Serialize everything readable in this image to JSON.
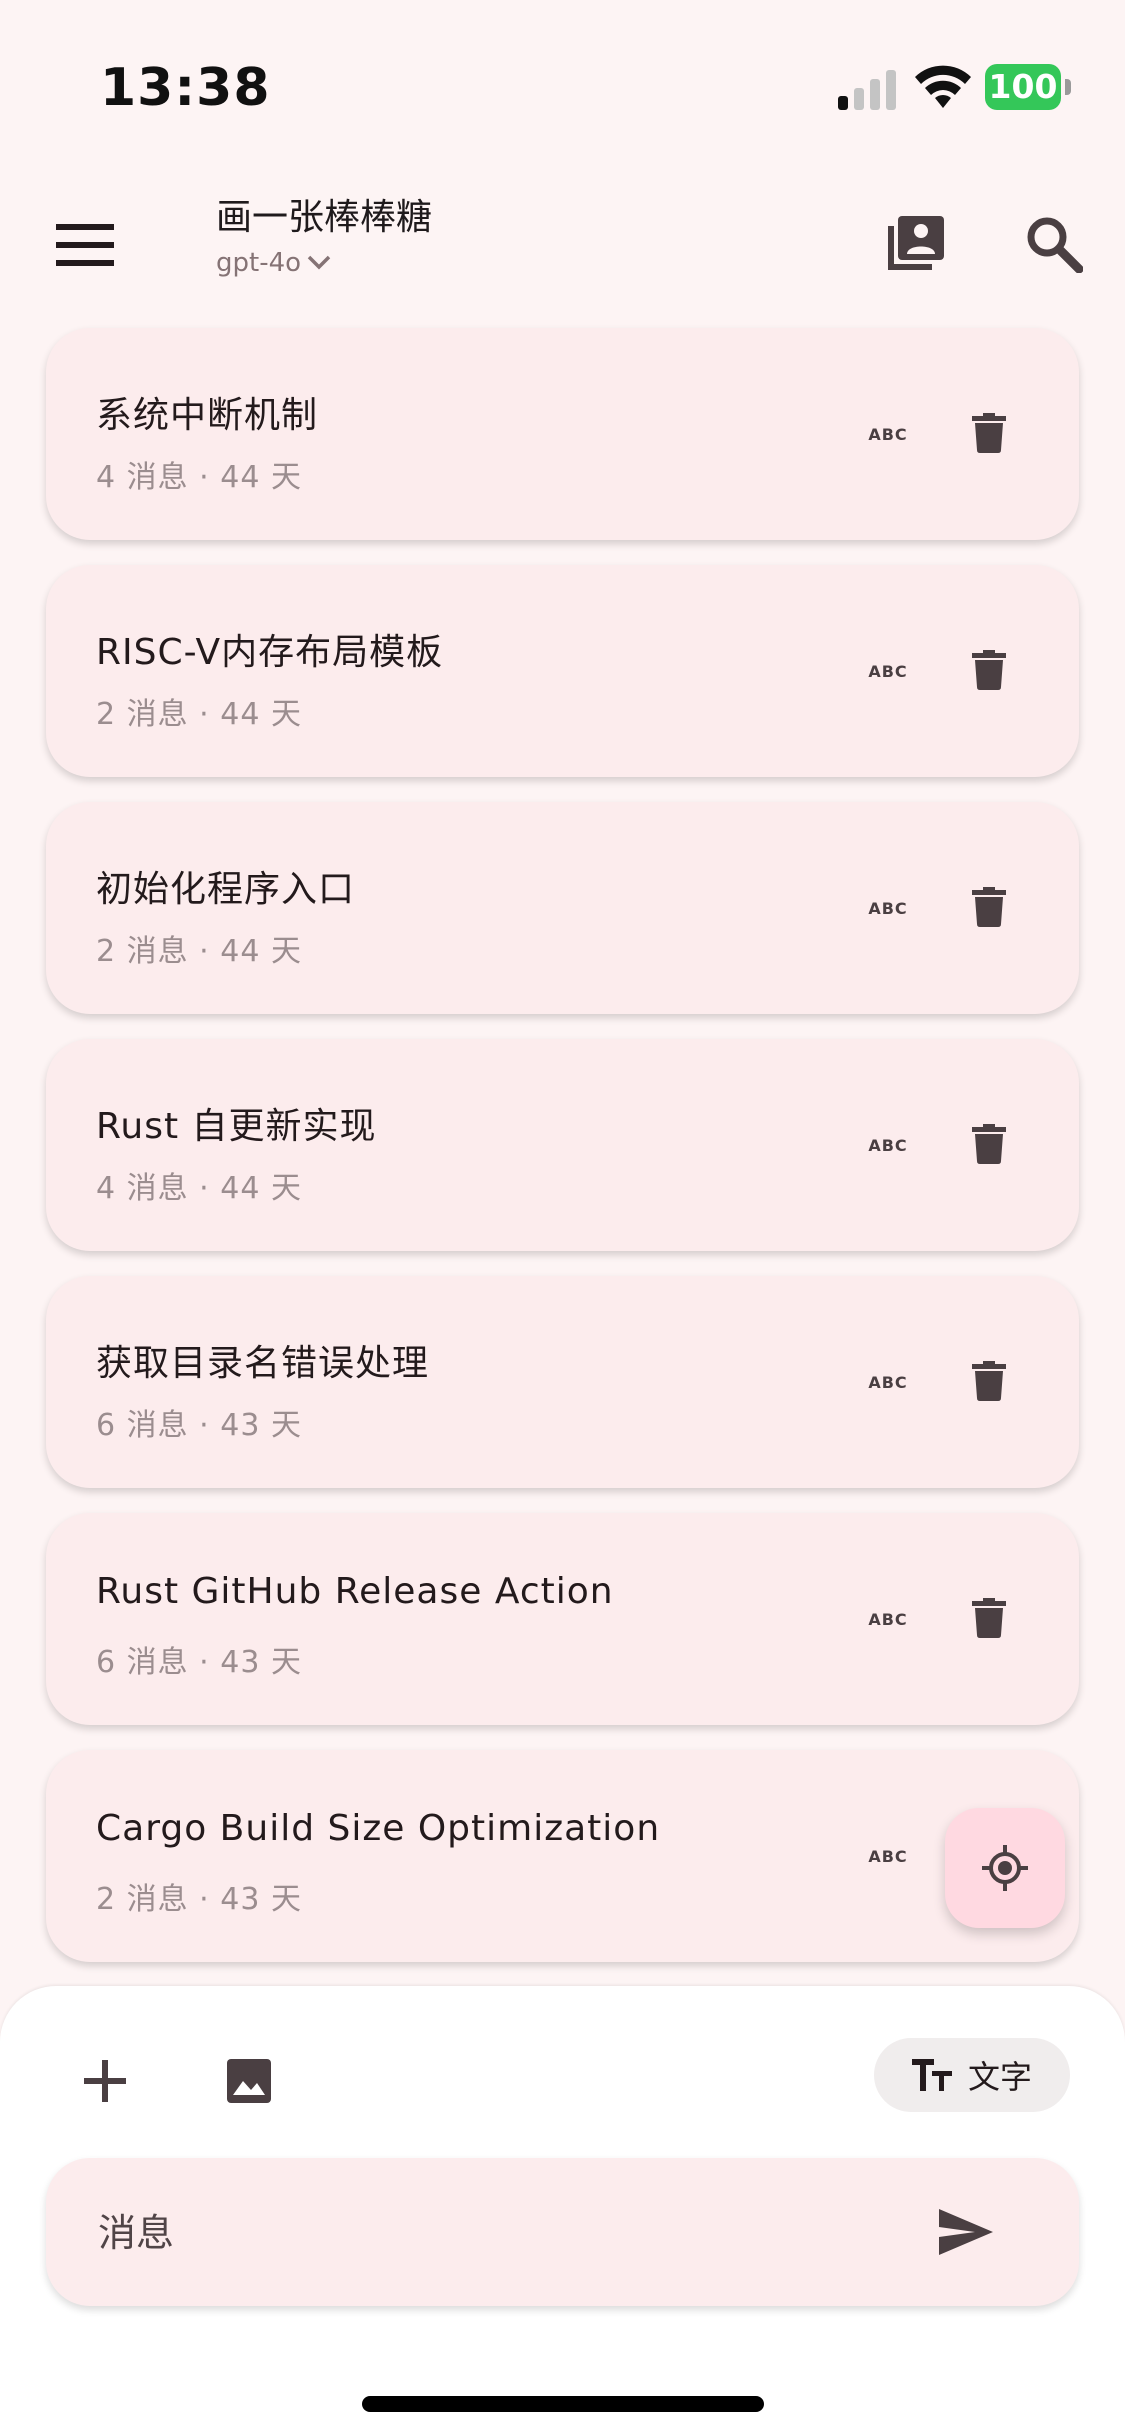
{
  "status_bar": {
    "time": "13:38",
    "battery": "100"
  },
  "header": {
    "title": "画一张棒棒糖",
    "model": "gpt-4o"
  },
  "conversations": [
    {
      "title": "系统中断机制",
      "meta": "4 消息 · 44 天"
    },
    {
      "title": "RISC-V内存布局模板",
      "meta": "2 消息 · 44 天"
    },
    {
      "title": "初始化程序入口",
      "meta": "2 消息 · 44 天"
    },
    {
      "title": "Rust 自更新实现",
      "meta": "4 消息 · 44 天"
    },
    {
      "title": "获取目录名错误处理",
      "meta": "6 消息 · 43 天"
    },
    {
      "title": "Rust GitHub Release Action",
      "meta": "6 消息 · 43 天"
    },
    {
      "title": "Cargo Build Size Optimization",
      "meta": "2 消息 · 43 天"
    }
  ],
  "abc_label": "ABC",
  "composer": {
    "mode_label": "文字",
    "placeholder": "消息"
  },
  "colors": {
    "card_bg": "#fceced",
    "fab_bg": "#ffd9e1",
    "icon": "#4a3f42",
    "accent": "#8b1a4a",
    "battery": "#34c759"
  }
}
